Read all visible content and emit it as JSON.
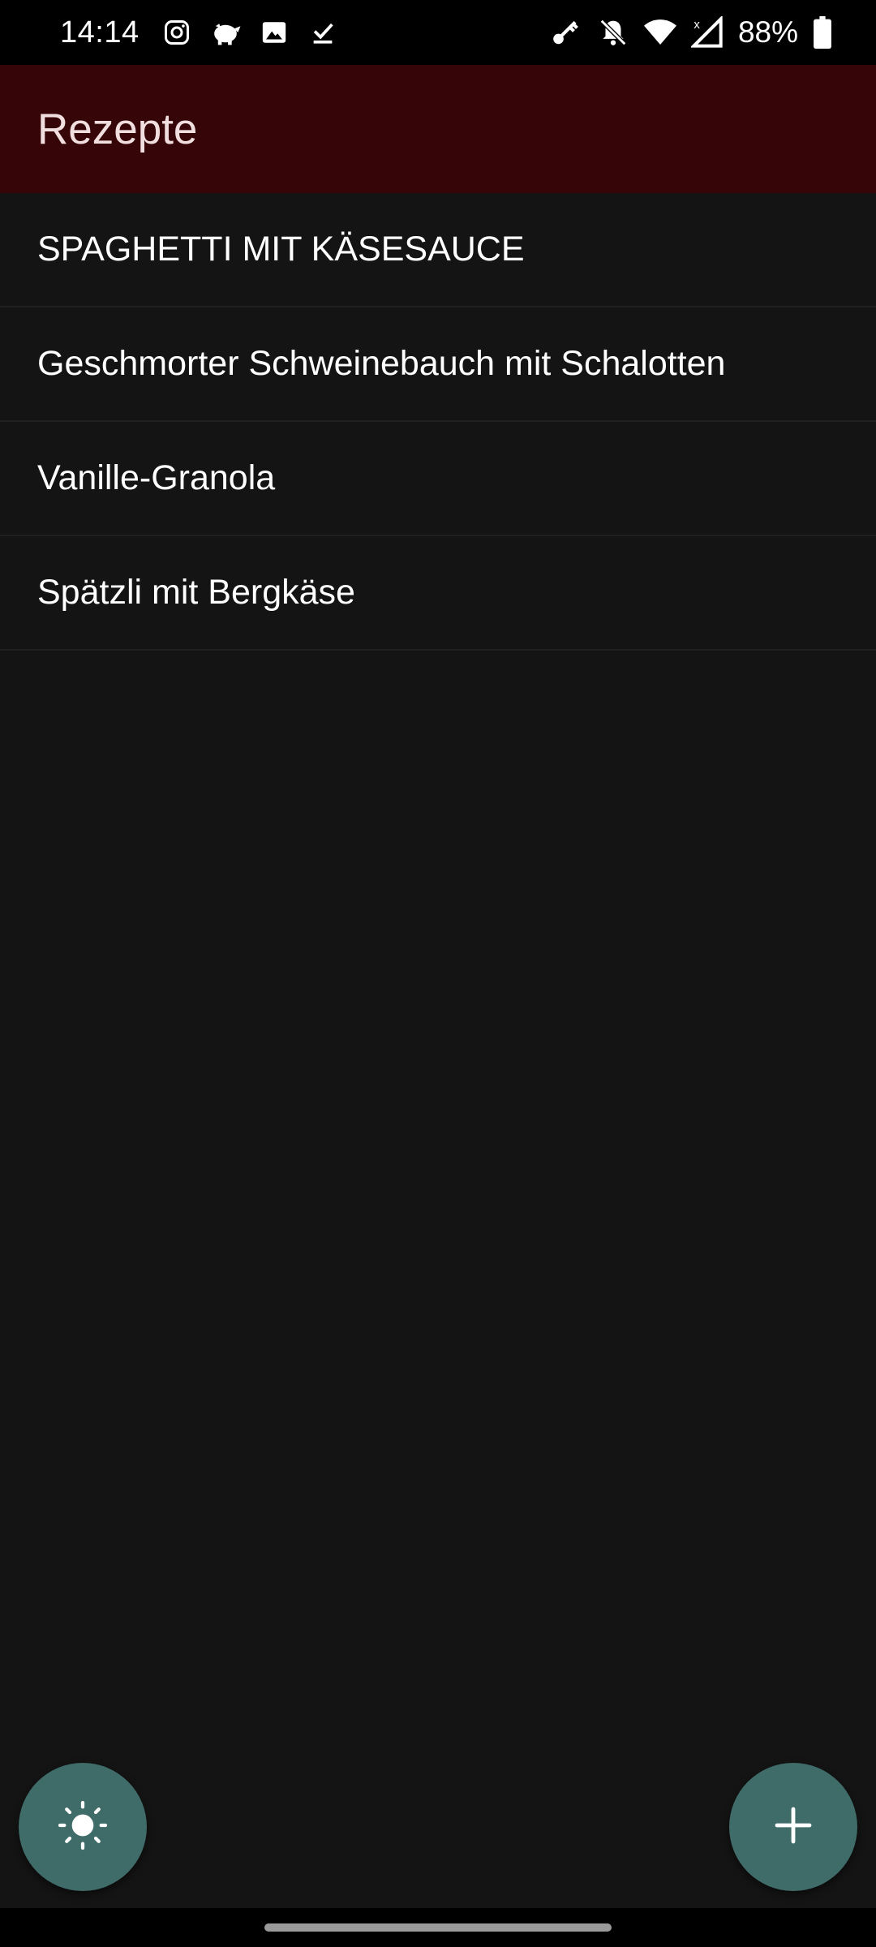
{
  "status_bar": {
    "time": "14:14",
    "battery_percent": "88%",
    "left_icons": [
      "instagram-icon",
      "piggy-bank-icon",
      "image-icon",
      "download-done-icon"
    ],
    "right_icons": [
      "key-icon",
      "notifications-off-icon",
      "wifi-icon",
      "signal-icon",
      "battery-icon"
    ]
  },
  "app_bar": {
    "title": "Rezepte",
    "color": "#360508"
  },
  "recipes": [
    {
      "label": "SPAGHETTI MIT KÄSESAUCE"
    },
    {
      "label": "Geschmorter Schweinebauch mit Schalotten"
    },
    {
      "label": "Vanille-Granola"
    },
    {
      "label": "Spätzli mit Bergkäse"
    }
  ],
  "fabs": {
    "theme_icon": "brightness-icon",
    "add_icon": "plus-icon",
    "color": "#3f6b68"
  },
  "colors": {
    "background": "#141414"
  }
}
